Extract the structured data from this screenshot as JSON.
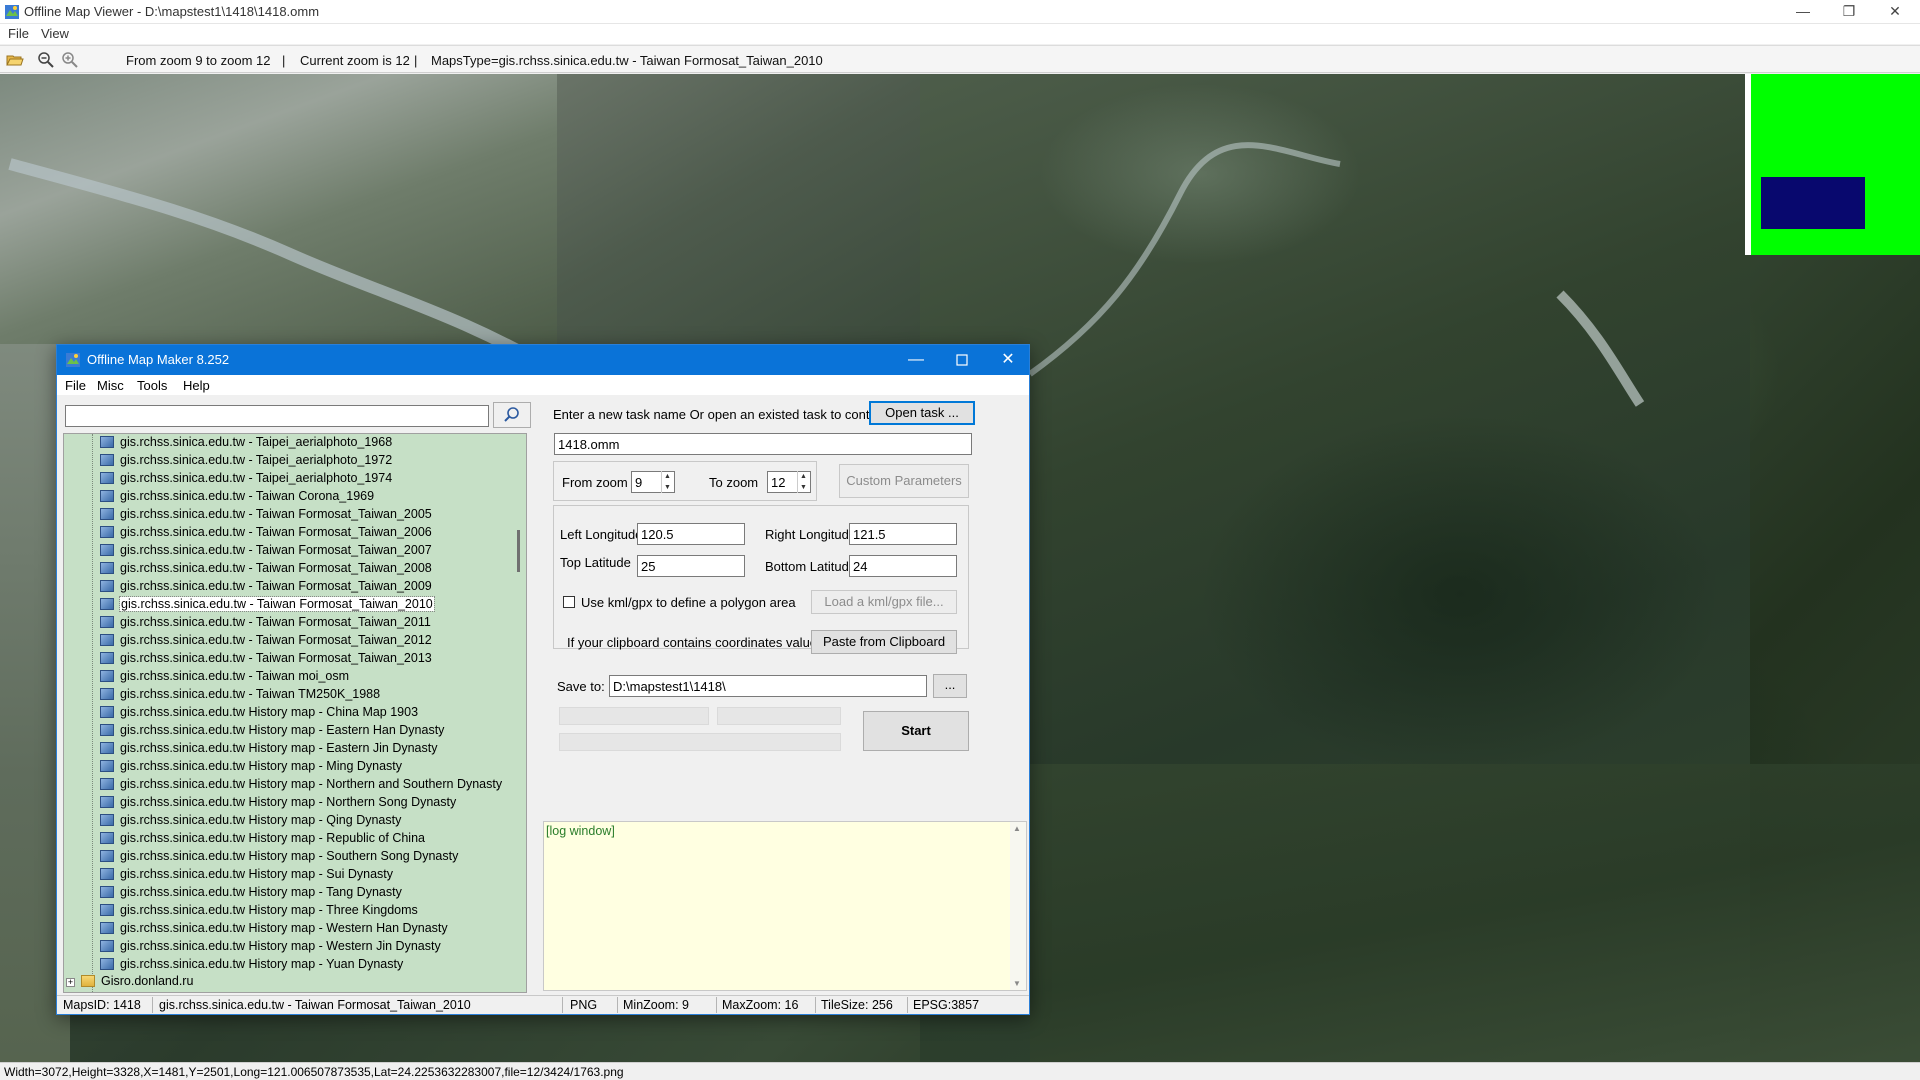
{
  "viewer": {
    "title": "Offline Map Viewer - D:\\mapstest1\\1418\\1418.omm",
    "menu": [
      "File",
      "View"
    ],
    "toolbar": {
      "zoom_range": "From zoom 9 to zoom 12",
      "current_zoom": "Current zoom is 12",
      "maps_type": "MapsType=gis.rchss.sinica.edu.tw - Taiwan Formosat_Taiwan_2010"
    },
    "status": "Width=3072,Height=3328,X=1481,Y=2501,Long=121.006507873535,Lat=24.2253632283007,file=12/3424/1763.png",
    "window_controls": {
      "minimize": "—",
      "maximize": "❐",
      "close": "✕"
    }
  },
  "dialog": {
    "title": "Offline Map Maker 8.252",
    "menu": [
      "File",
      "Misc",
      "Tools",
      "Help"
    ],
    "search_value": "",
    "tree_items": [
      "gis.rchss.sinica.edu.tw - Taipei_aerialphoto_1968",
      "gis.rchss.sinica.edu.tw - Taipei_aerialphoto_1972",
      "gis.rchss.sinica.edu.tw - Taipei_aerialphoto_1974",
      "gis.rchss.sinica.edu.tw - Taiwan Corona_1969",
      "gis.rchss.sinica.edu.tw - Taiwan Formosat_Taiwan_2005",
      "gis.rchss.sinica.edu.tw - Taiwan Formosat_Taiwan_2006",
      "gis.rchss.sinica.edu.tw - Taiwan Formosat_Taiwan_2007",
      "gis.rchss.sinica.edu.tw - Taiwan Formosat_Taiwan_2008",
      "gis.rchss.sinica.edu.tw - Taiwan Formosat_Taiwan_2009",
      "gis.rchss.sinica.edu.tw - Taiwan Formosat_Taiwan_2010",
      "gis.rchss.sinica.edu.tw - Taiwan Formosat_Taiwan_2011",
      "gis.rchss.sinica.edu.tw - Taiwan Formosat_Taiwan_2012",
      "gis.rchss.sinica.edu.tw - Taiwan Formosat_Taiwan_2013",
      "gis.rchss.sinica.edu.tw - Taiwan moi_osm",
      "gis.rchss.sinica.edu.tw - Taiwan TM250K_1988",
      "gis.rchss.sinica.edu.tw History map - China Map 1903",
      "gis.rchss.sinica.edu.tw History map - Eastern Han Dynasty",
      "gis.rchss.sinica.edu.tw History map - Eastern Jin Dynasty",
      "gis.rchss.sinica.edu.tw History map - Ming Dynasty",
      "gis.rchss.sinica.edu.tw History map - Northern and Southern Dynasty",
      "gis.rchss.sinica.edu.tw History map - Northern Song Dynasty",
      "gis.rchss.sinica.edu.tw History map - Qing Dynasty",
      "gis.rchss.sinica.edu.tw History map - Republic of China",
      "gis.rchss.sinica.edu.tw History map - Southern Song Dynasty",
      "gis.rchss.sinica.edu.tw History map - Sui Dynasty",
      "gis.rchss.sinica.edu.tw History map - Tang Dynasty",
      "gis.rchss.sinica.edu.tw History map - Three Kingdoms",
      "gis.rchss.sinica.edu.tw History map - Western Han Dynasty",
      "gis.rchss.sinica.edu.tw History map - Western Jin Dynasty",
      "gis.rchss.sinica.edu.tw History map - Yuan Dynasty"
    ],
    "selected_item": "gis.rchss.sinica.edu.tw - Taiwan Formosat_Taiwan_2010",
    "folder_item": "Gisro.donland.ru",
    "task_prompt": "Enter a new task name Or open an existed task to continue:",
    "open_task_button": "Open task ...",
    "task_name": "1418.omm",
    "from_zoom_label": "From zoom",
    "from_zoom": "9",
    "to_zoom_label": "To zoom",
    "to_zoom": "12",
    "custom_params_button": "Custom Parameters",
    "left_lon_label": "Left Longitude",
    "left_lon": "120.5",
    "right_lon_label": "Right Longitude",
    "right_lon": "121.5",
    "top_lat_label": "Top Latitude",
    "top_lat": "25",
    "bottom_lat_label": "Bottom Latitude",
    "bottom_lat": "24",
    "kml_checkbox_label": "Use kml/gpx to define a polygon area",
    "load_kml_button": "Load a kml/gpx file...",
    "clipboard_label": "If your clipboard contains coordinates values:",
    "paste_button": "Paste from Clipboard",
    "save_to_label": "Save to:",
    "save_to": "D:\\mapstest1\\1418\\",
    "browse_button": "...",
    "start_button": "Start",
    "log_text": "[log window]",
    "status": {
      "maps_id": "MapsID: 1418",
      "map_name": "gis.rchss.sinica.edu.tw - Taiwan Formosat_Taiwan_2010",
      "format": "PNG",
      "min_zoom": "MinZoom: 9",
      "max_zoom": "MaxZoom: 16",
      "tile_size": "TileSize: 256",
      "epsg": "EPSG:3857"
    }
  }
}
